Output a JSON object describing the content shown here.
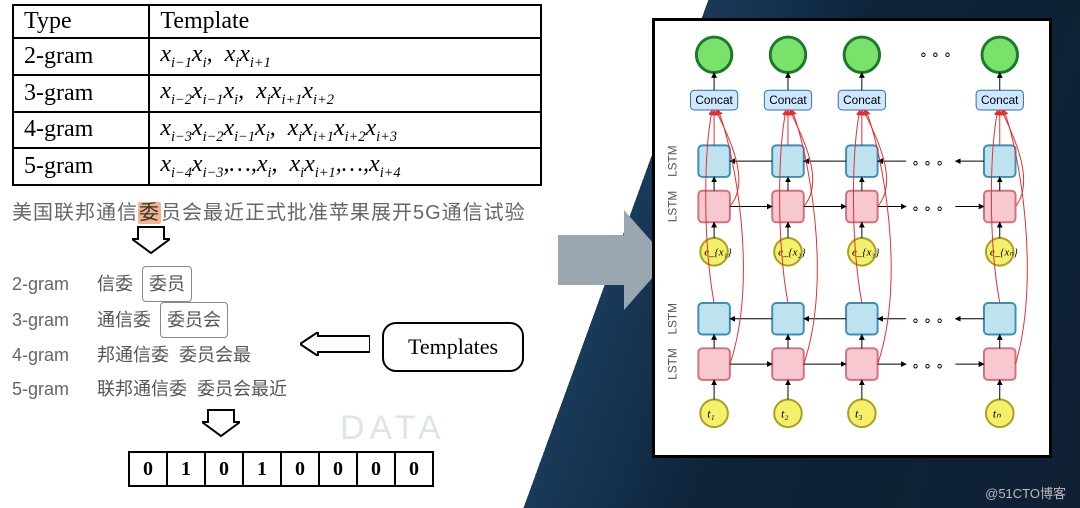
{
  "table": {
    "header": {
      "left": "Type",
      "right": "Template"
    },
    "rows": [
      {
        "type": "2-gram",
        "a": "x_{i-1}x_i,",
        "b": "x_i x_{i+1}"
      },
      {
        "type": "3-gram",
        "a": "x_{i-2}x_{i-1}x_i,",
        "b": "x_i x_{i+1}x_{i+2}"
      },
      {
        "type": "4-gram",
        "a": "x_{i-3}x_{i-2}x_{i-1}x_i,",
        "b": "x_i x_{i+1}x_{i+2}x_{i+3}"
      },
      {
        "type": "5-gram",
        "a": "x_{i-4}x_{i-3},...,x_i,",
        "b": "x_i x_{i+1},...,x_{i+4}"
      }
    ]
  },
  "sentence": {
    "pre": "美国联邦通信",
    "hl": "委",
    "post": "员会最近正式批准苹果展开5G通信试验"
  },
  "ngrams": [
    {
      "lbl": "2-gram",
      "seg1": "信委",
      "seg2": "委员",
      "box": true
    },
    {
      "lbl": "3-gram",
      "seg1": "通信委",
      "seg2": "委员会",
      "box": true
    },
    {
      "lbl": "4-gram",
      "seg1": "邦通信委",
      "seg2": "委员会最",
      "box": false
    },
    {
      "lbl": "5-gram",
      "seg1": "联邦通信委",
      "seg2": "委员会最近",
      "box": false
    }
  ],
  "templates_label": "Templates",
  "binary": [
    "0",
    "1",
    "0",
    "1",
    "0",
    "0",
    "0",
    "0"
  ],
  "net": {
    "concat_label": "Concat",
    "lstm_label": "LSTM",
    "t_labels": [
      "t₁",
      "t₂",
      "t₃",
      "tₙ"
    ],
    "e_labels": [
      "e_{x₁}",
      "e_{x₂}",
      "e_{x₃}",
      "e_{xₙ}"
    ]
  },
  "watermark": "DATA",
  "credit": "@51CTO博客"
}
